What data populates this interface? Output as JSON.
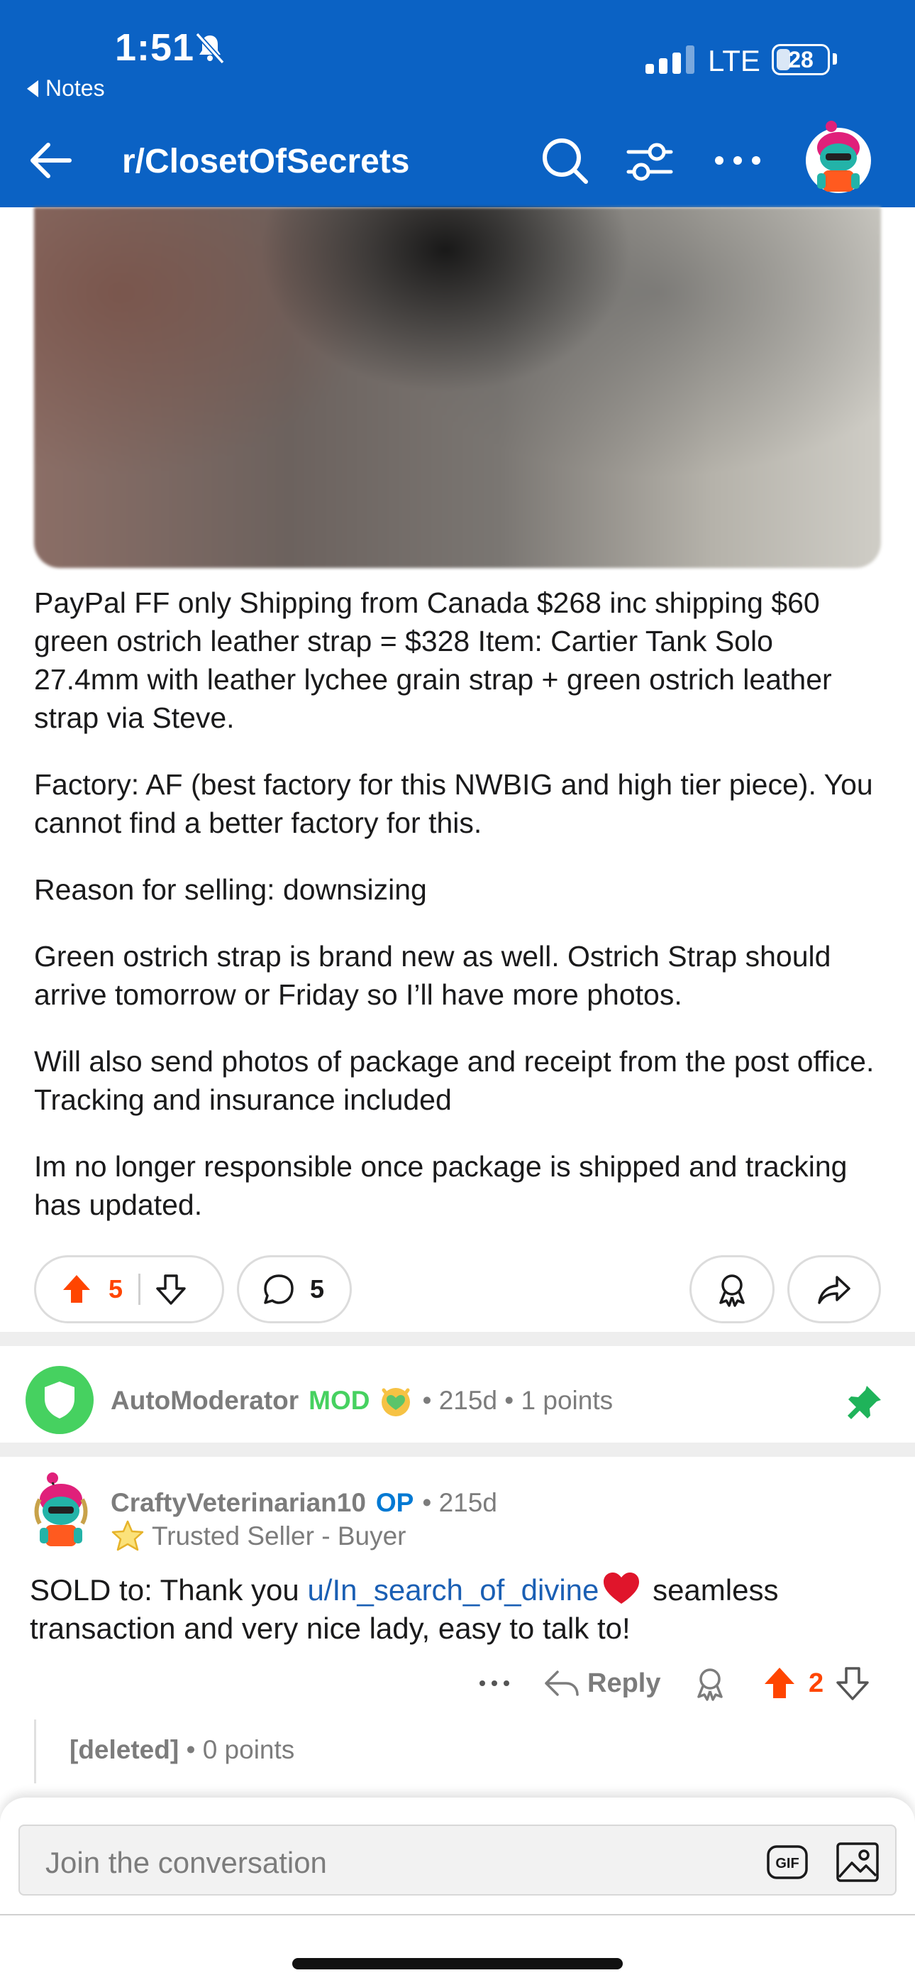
{
  "status_bar": {
    "time": "1:51",
    "back_app": "Notes",
    "network": "LTE",
    "battery": "28",
    "battery_level": 0.28
  },
  "nav": {
    "title": "r/ClosetOfSecrets",
    "icons": [
      "back-arrow-icon",
      "search-icon",
      "filter-icon",
      "more-icon",
      "avatar"
    ]
  },
  "post": {
    "image_description": "blurred",
    "body": [
      "PayPal FF only Shipping from Canada $268 inc shipping $60 green ostrich leather strap = $328 Item: Cartier Tank Solo 27.4mm with leather lychee grain strap + green ostrich leather strap via Steve.",
      "Factory: AF (best factory for this NWBIG and high tier piece). You cannot find a better factory for this.",
      "Reason for selling: downsizing",
      "Green ostrich strap is brand new as well. Ostrich Strap should arrive tomorrow or Friday so I’ll have more photos.",
      "Will also send photos of package and receipt from the post office. Tracking and insurance included",
      "Im no longer responsible once package is shipped and tracking has updated."
    ],
    "votes": "5",
    "comments": "5"
  },
  "automod": {
    "author": "AutoModerator",
    "badge": "MOD",
    "meta": "• 215d • 1 points"
  },
  "comment": {
    "author": "CraftyVeterinarian10",
    "badge": "OP",
    "meta": "• 215d",
    "flair": "Trusted Seller - Buyer",
    "text_before": "SOLD to: Thank you ",
    "link": "u/In_search_of_divine",
    "text_after": " seamless transaction and very nice lady, easy to talk to!",
    "reply_label": "Reply",
    "votes": "2"
  },
  "deleted": {
    "author": "[deleted]",
    "meta": "• 0 points"
  },
  "composer": {
    "placeholder": "Join the conversation",
    "gif_label": "GIF"
  },
  "colors": {
    "header": "#0b62c4",
    "upvote": "#ff4500",
    "mod": "#46d160",
    "op": "#0079d3",
    "link": "#1a5fb4"
  }
}
